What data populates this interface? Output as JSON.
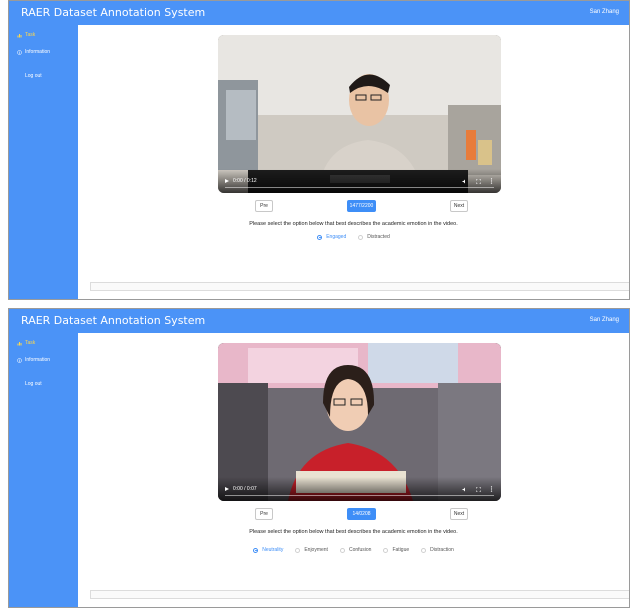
{
  "colors": {
    "brand": "#4b93f7",
    "active_nav": "#ffd84a",
    "accent": "#3e8ef7"
  },
  "screens": [
    {
      "header": {
        "title": "RAER Dataset Annotation System",
        "user": "San Zhang"
      },
      "sidebar": {
        "items": [
          {
            "label": "Task",
            "icon": "chart-icon"
          },
          {
            "label": "Information",
            "icon": "info-icon"
          },
          {
            "label": "Log out"
          }
        ]
      },
      "video": {
        "time": "0:00 / 0:12",
        "progress": 0
      },
      "nav": {
        "pre": "Pre",
        "counter": "1477/2200",
        "next": "Next"
      },
      "question": "Please select the option below that best describes the academic emotion in the video.",
      "options": [
        "Engaged",
        "Distracted"
      ],
      "selected": "Engaged"
    },
    {
      "header": {
        "title": "RAER Dataset Annotation System",
        "user": "San Zhang"
      },
      "sidebar": {
        "items": [
          {
            "label": "Task",
            "icon": "chart-icon"
          },
          {
            "label": "Information",
            "icon": "info-icon"
          },
          {
            "label": "Log out"
          }
        ]
      },
      "video": {
        "time": "0:00 / 0:07",
        "progress": 0
      },
      "nav": {
        "pre": "Pre",
        "counter": "14/0208",
        "next": "Next"
      },
      "question": "Please select the option below that best describes the academic emotion in the video.",
      "options": [
        "Neutrality",
        "Enjoyment",
        "Confusion",
        "Fatigue",
        "Distraction"
      ],
      "selected": "Neutrality"
    }
  ]
}
